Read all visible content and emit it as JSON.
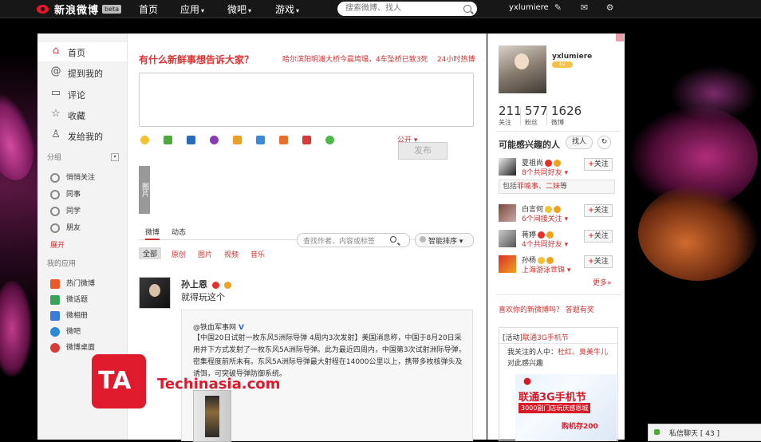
{
  "topbar": {
    "logo_text": "新浪微博",
    "beta": "beta",
    "nav": [
      {
        "label": "首页",
        "caret": ""
      },
      {
        "label": "应用",
        "caret": "▾"
      },
      {
        "label": "微吧",
        "caret": "▾"
      },
      {
        "label": "游戏",
        "caret": "▾"
      }
    ],
    "search_placeholder": "搜索微博、找人",
    "username": "yxlumiere"
  },
  "sidebar": {
    "items": [
      {
        "label": "首页",
        "icon": "home-icon"
      },
      {
        "label": "提到我的",
        "icon": "at-icon"
      },
      {
        "label": "评论",
        "icon": "comment-icon"
      },
      {
        "label": "收藏",
        "icon": "star-icon"
      },
      {
        "label": "发给我的",
        "icon": "user-icon"
      }
    ],
    "group_heading": "分组",
    "groups": [
      "悄悄关注",
      "同事",
      "同学",
      "朋友"
    ],
    "expand": "展开",
    "apps_heading": "我的应用",
    "apps": [
      {
        "label": "热门微博",
        "color": "#e85a2a"
      },
      {
        "label": "微话题",
        "color": "#3aa35a"
      },
      {
        "label": "微相册",
        "color": "#3a7ad8"
      },
      {
        "label": "微吧",
        "color": "#2a8ad8"
      },
      {
        "label": "微博桌面",
        "color": "#d83a3a"
      }
    ]
  },
  "main": {
    "prompt": "有什么新鲜事想告诉大家？",
    "hot_topic": "哈尔滨阳明滩大桥今晨垮塌，4车坠桥已致3死",
    "hot_24": "24小时热博",
    "public": "公开 ▾",
    "post_button": "发布",
    "side_tab": "图片",
    "tabs": [
      "微博",
      "动态"
    ],
    "feed_search_placeholder": "查找作者、内容或标签",
    "smart_sort": "智能排序 ▾",
    "filters": [
      "全部",
      "原创",
      "图片",
      "视频",
      "音乐"
    ],
    "post": {
      "author": "孙上恩",
      "text": "就得玩这个",
      "repost_author": "@铁血军事网",
      "repost_text": "【中国20日试射一枚东风5洲际导弹 4周内3次发射】美国消息称，中国于8月20日采用井下方式发射了一枚东风5A洲际导弹。此为最近四周内，中国第3次试射洲际导弹，密集程度前所未有。东风5A洲际导弹最大射程在14000公里以上，携带多枚核弹头及诱饵，可突破导弹防御系统。"
    }
  },
  "watermark": {
    "text": "Techinasia.com"
  },
  "right": {
    "name": "yxlumiere",
    "level": "Lv",
    "stats": [
      {
        "value": "211",
        "label": "关注"
      },
      {
        "value": "577",
        "label": "粉丝"
      },
      {
        "value": "1626",
        "label": "微博"
      }
    ],
    "suggest_title": "可能感兴趣的人",
    "find_btn": "找人",
    "follow_label": "关注",
    "suggestions": [
      {
        "name": "夏祖尚",
        "sub": "8个共同好友 ▾"
      },
      {
        "name": "白言何",
        "sub": "6个间接关注 ▾"
      },
      {
        "name": "蒋婷",
        "sub": "4个共同好友 ▾"
      },
      {
        "name": "孙杨",
        "sub": "上海游泳世锦 ▾"
      }
    ],
    "mutual_prefix": "包括",
    "mutual_names": "菲喻事、二妹",
    "mutual_suffix": "等",
    "more": "更多»",
    "like_q": "喜欢你的新微博吗？",
    "like_a": "答题有奖",
    "activity_title_prefix": "[活动]",
    "activity_title": "联通3G手机节",
    "activity_sub_prefix": "我关注的人中：",
    "activity_sub_names": "杜红、臭美牛儿",
    "activity_sub_suffix": "对此感兴趣",
    "ad_line1": "联通3G手机节",
    "ad_line2": "3000副门店玩庆感恩城",
    "ad_line3": "购机存200"
  },
  "chat": {
    "label": "私信聊天 [ 43 ]"
  }
}
